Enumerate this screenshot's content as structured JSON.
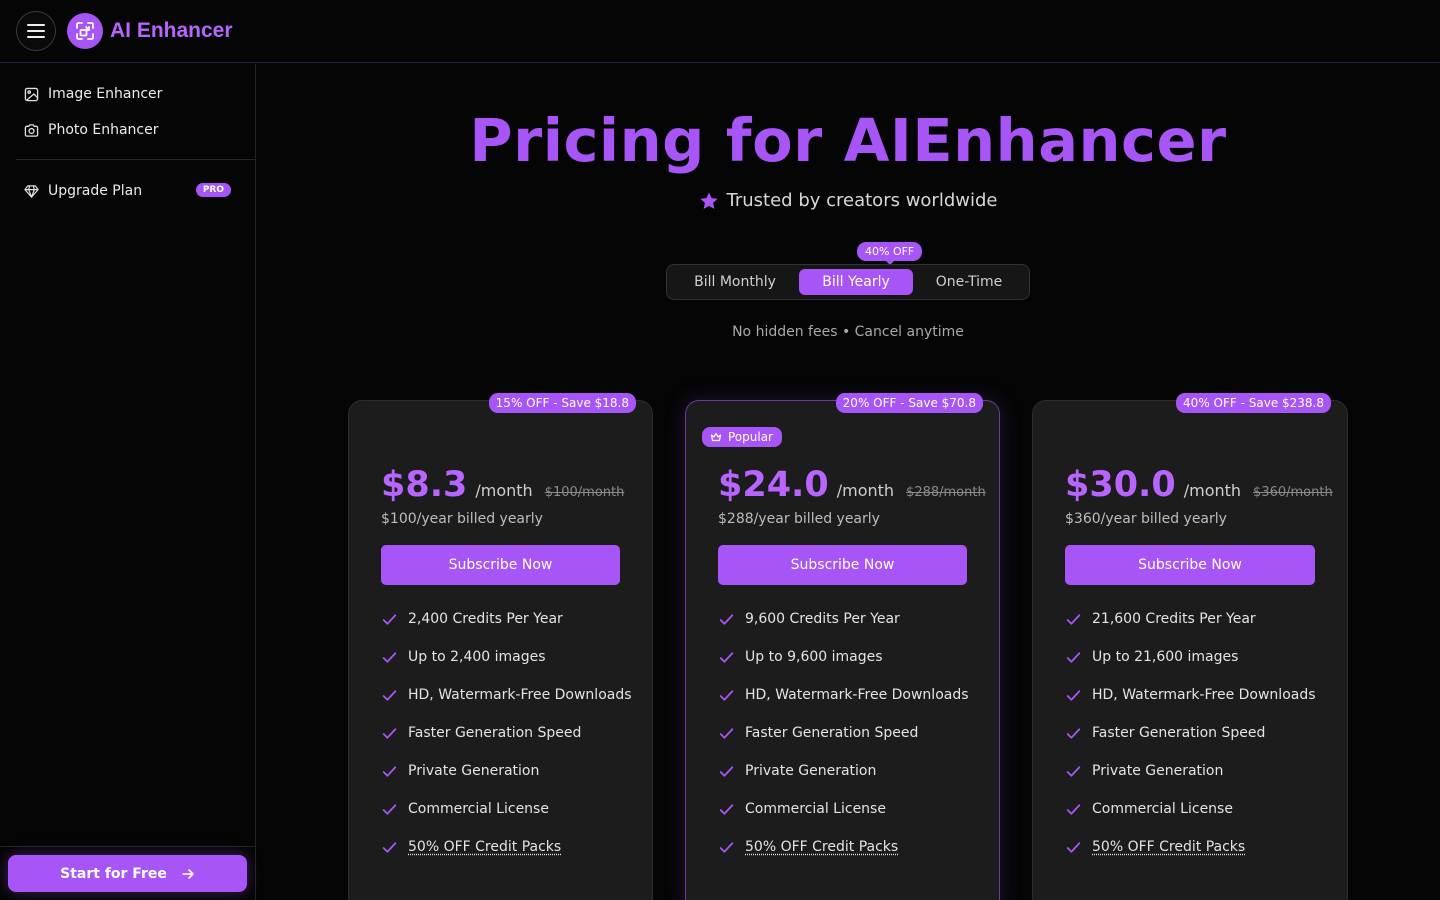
{
  "app": {
    "name": "AI Enhancer"
  },
  "sidebar": {
    "items": [
      {
        "label": "Image Enhancer",
        "icon": "image-icon"
      },
      {
        "label": "Photo Enhancer",
        "icon": "camera-icon"
      }
    ],
    "upgrade": {
      "label": "Upgrade Plan",
      "badge": "PRO",
      "icon": "diamond-icon"
    },
    "cta": {
      "label": "Start for Free",
      "icon": "arrow-right-icon"
    }
  },
  "hero": {
    "title": "Pricing for AIEnhancer",
    "subtitle": "Trusted by creators worldwide"
  },
  "billing": {
    "options": [
      "Bill Monthly",
      "Bill Yearly",
      "One-Time"
    ],
    "selected": "Bill Yearly",
    "discount_tag": "40% OFF",
    "note": "No hidden fees • Cancel anytime"
  },
  "colors": {
    "accent": "#a855f7",
    "background": "#050505",
    "card": "#1c1c1c"
  },
  "plans": [
    {
      "save_tag": "15% OFF - Save $18.8",
      "price": "$8.3",
      "period": "/month",
      "old_price": "$100/month",
      "billed": "$100/year billed yearly",
      "cta": "Subscribe Now",
      "features": [
        "2,400 Credits Per Year",
        "Up to 2,400 images",
        "HD, Watermark-Free Downloads",
        "Faster Generation Speed",
        "Private Generation",
        "Commercial License",
        "50% OFF Credit Packs"
      ]
    },
    {
      "popular_label": "Popular",
      "save_tag": "20% OFF - Save $70.8",
      "price": "$24.0",
      "period": "/month",
      "old_price": "$288/month",
      "billed": "$288/year billed yearly",
      "cta": "Subscribe Now",
      "features": [
        "9,600 Credits Per Year",
        "Up to 9,600 images",
        "HD, Watermark-Free Downloads",
        "Faster Generation Speed",
        "Private Generation",
        "Commercial License",
        "50% OFF Credit Packs"
      ]
    },
    {
      "save_tag": "40% OFF - Save $238.8",
      "price": "$30.0",
      "period": "/month",
      "old_price": "$360/month",
      "billed": "$360/year billed yearly",
      "cta": "Subscribe Now",
      "features": [
        "21,600 Credits Per Year",
        "Up to 21,600 images",
        "HD, Watermark-Free Downloads",
        "Faster Generation Speed",
        "Private Generation",
        "Commercial License",
        "50% OFF Credit Packs"
      ]
    }
  ]
}
